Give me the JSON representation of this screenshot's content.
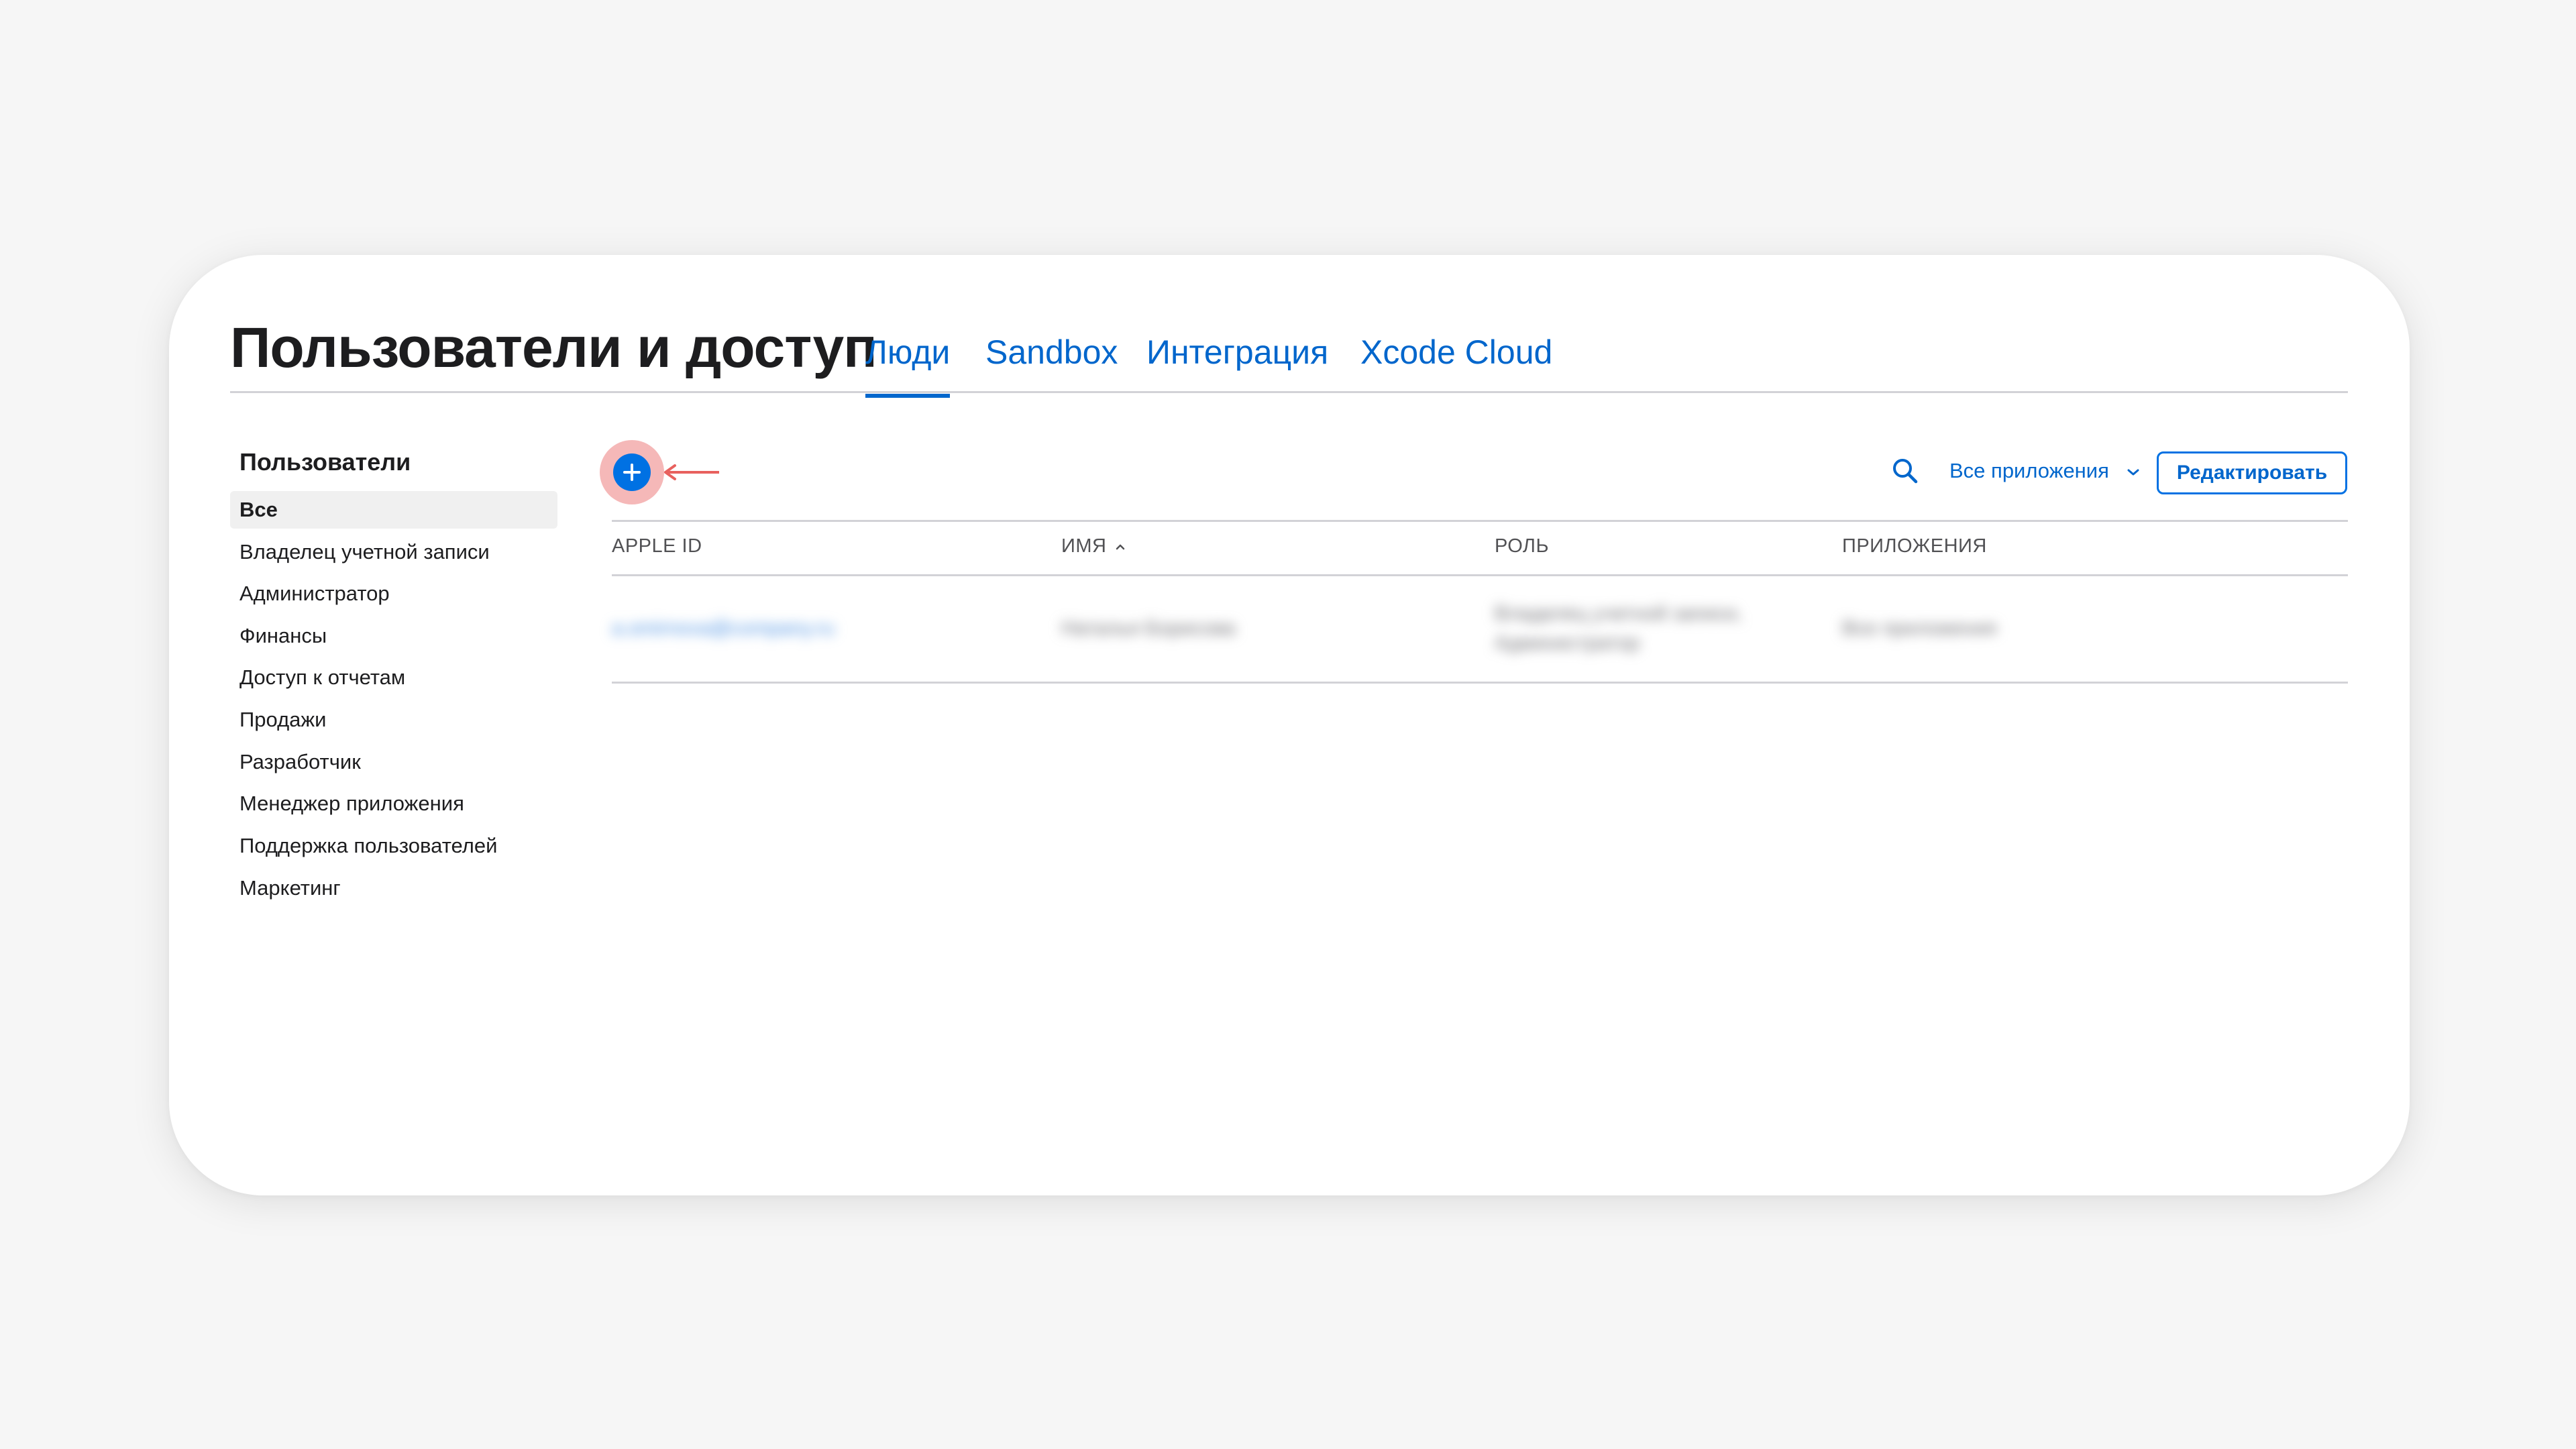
{
  "header": {
    "title": "Пользователи и доступ",
    "tabs": [
      {
        "label": "Люди",
        "active": true
      },
      {
        "label": "Sandbox",
        "active": false
      },
      {
        "label": "Интеграция",
        "active": false
      },
      {
        "label": "Xcode Cloud",
        "active": false
      }
    ]
  },
  "sidebar": {
    "heading": "Пользователи",
    "items": [
      {
        "label": "Все",
        "selected": true
      },
      {
        "label": "Владелец учетной записи",
        "selected": false
      },
      {
        "label": "Администратор",
        "selected": false
      },
      {
        "label": "Финансы",
        "selected": false
      },
      {
        "label": "Доступ к отчетам",
        "selected": false
      },
      {
        "label": "Продажи",
        "selected": false
      },
      {
        "label": "Разработчик",
        "selected": false
      },
      {
        "label": "Менеджер приложения",
        "selected": false
      },
      {
        "label": "Поддержка пользователей",
        "selected": false
      },
      {
        "label": "Маркетинг",
        "selected": false
      }
    ]
  },
  "toolbar": {
    "add_icon": "plus-icon",
    "search_icon": "search-icon",
    "apps_filter": "Все приложения",
    "apps_filter_icon": "chevron-down-icon",
    "edit_label": "Редактировать"
  },
  "table": {
    "columns": [
      "APPLE ID",
      "ИМЯ",
      "РОЛЬ",
      "ПРИЛОЖЕНИЯ"
    ],
    "sorted_column": "ИМЯ",
    "sort_direction": "ascending",
    "rows": [
      {
        "apple_id": "a.smirnova@company.ru",
        "name": "Наталья Борисова",
        "role_line1": "Владелец учетной записи,",
        "role_line2": "Администратор",
        "apps": "Все приложения"
      }
    ]
  },
  "colors": {
    "accent": "#0071e3",
    "link": "#0066cc",
    "highlight": "#f5b8b8",
    "arrow": "#e8615e"
  }
}
